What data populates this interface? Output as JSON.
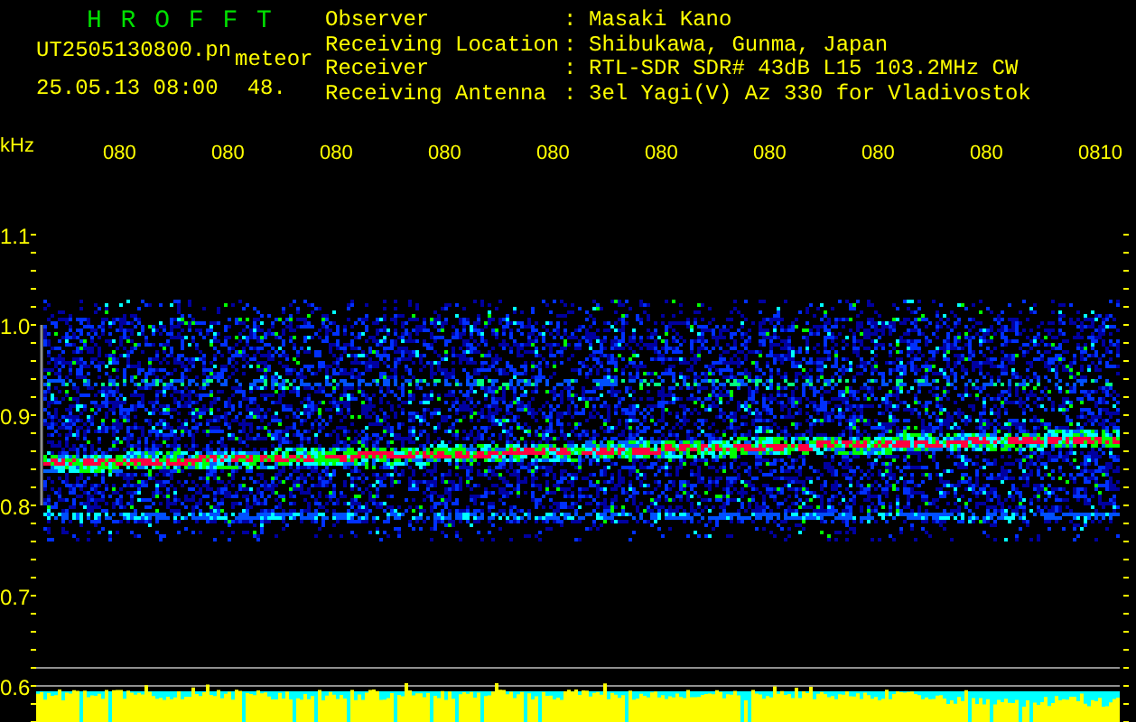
{
  "header": {
    "title": "H R O F F T",
    "file_name": "UT2505130800.pn",
    "mode": "meteor",
    "timestamp": "25.05.13 08:00",
    "count": "48.",
    "fields": [
      {
        "label": "Observer",
        "separator": ":",
        "value": "Masaki Kano"
      },
      {
        "label": "Receiving Location",
        "separator": ":",
        "value": "Shibukawa, Gunma, Japan"
      },
      {
        "label": "Receiver",
        "separator": ":",
        "value": "RTL-SDR SDR# 43dB L15 103.2MHz CW"
      },
      {
        "label": "Receiving Antenna",
        "separator": ":",
        "value": "3el Yagi(V) Az 330 for Vladivostok"
      }
    ]
  },
  "spectrogram": {
    "frequency_unit": "kHz",
    "frequency_labels": [
      "1.1",
      "1.0",
      "0.9",
      "0.8",
      "0.7",
      "0.6"
    ],
    "time_labels": [
      "080",
      "080",
      "080",
      "080",
      "080",
      "080",
      "080",
      "080",
      "080",
      "0810"
    ]
  }
}
